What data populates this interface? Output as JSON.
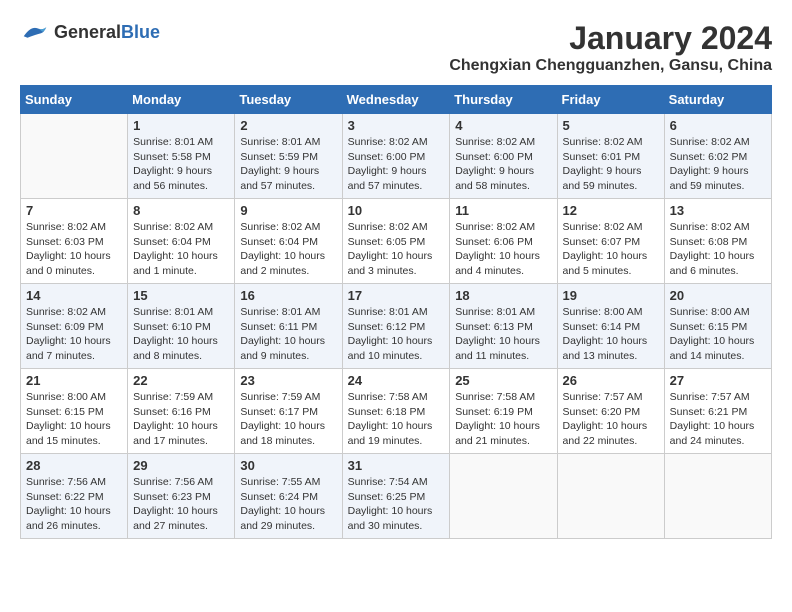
{
  "header": {
    "logo_line1": "General",
    "logo_line2": "Blue",
    "month": "January 2024",
    "location": "Chengxian Chengguanzhen, Gansu, China"
  },
  "weekdays": [
    "Sunday",
    "Monday",
    "Tuesday",
    "Wednesday",
    "Thursday",
    "Friday",
    "Saturday"
  ],
  "weeks": [
    [
      {
        "day": "",
        "sunrise": "",
        "sunset": "",
        "daylight": ""
      },
      {
        "day": "1",
        "sunrise": "Sunrise: 8:01 AM",
        "sunset": "Sunset: 5:58 PM",
        "daylight": "Daylight: 9 hours and 56 minutes."
      },
      {
        "day": "2",
        "sunrise": "Sunrise: 8:01 AM",
        "sunset": "Sunset: 5:59 PM",
        "daylight": "Daylight: 9 hours and 57 minutes."
      },
      {
        "day": "3",
        "sunrise": "Sunrise: 8:02 AM",
        "sunset": "Sunset: 6:00 PM",
        "daylight": "Daylight: 9 hours and 57 minutes."
      },
      {
        "day": "4",
        "sunrise": "Sunrise: 8:02 AM",
        "sunset": "Sunset: 6:00 PM",
        "daylight": "Daylight: 9 hours and 58 minutes."
      },
      {
        "day": "5",
        "sunrise": "Sunrise: 8:02 AM",
        "sunset": "Sunset: 6:01 PM",
        "daylight": "Daylight: 9 hours and 59 minutes."
      },
      {
        "day": "6",
        "sunrise": "Sunrise: 8:02 AM",
        "sunset": "Sunset: 6:02 PM",
        "daylight": "Daylight: 9 hours and 59 minutes."
      }
    ],
    [
      {
        "day": "7",
        "sunrise": "Sunrise: 8:02 AM",
        "sunset": "Sunset: 6:03 PM",
        "daylight": "Daylight: 10 hours and 0 minutes."
      },
      {
        "day": "8",
        "sunrise": "Sunrise: 8:02 AM",
        "sunset": "Sunset: 6:04 PM",
        "daylight": "Daylight: 10 hours and 1 minute."
      },
      {
        "day": "9",
        "sunrise": "Sunrise: 8:02 AM",
        "sunset": "Sunset: 6:04 PM",
        "daylight": "Daylight: 10 hours and 2 minutes."
      },
      {
        "day": "10",
        "sunrise": "Sunrise: 8:02 AM",
        "sunset": "Sunset: 6:05 PM",
        "daylight": "Daylight: 10 hours and 3 minutes."
      },
      {
        "day": "11",
        "sunrise": "Sunrise: 8:02 AM",
        "sunset": "Sunset: 6:06 PM",
        "daylight": "Daylight: 10 hours and 4 minutes."
      },
      {
        "day": "12",
        "sunrise": "Sunrise: 8:02 AM",
        "sunset": "Sunset: 6:07 PM",
        "daylight": "Daylight: 10 hours and 5 minutes."
      },
      {
        "day": "13",
        "sunrise": "Sunrise: 8:02 AM",
        "sunset": "Sunset: 6:08 PM",
        "daylight": "Daylight: 10 hours and 6 minutes."
      }
    ],
    [
      {
        "day": "14",
        "sunrise": "Sunrise: 8:02 AM",
        "sunset": "Sunset: 6:09 PM",
        "daylight": "Daylight: 10 hours and 7 minutes."
      },
      {
        "day": "15",
        "sunrise": "Sunrise: 8:01 AM",
        "sunset": "Sunset: 6:10 PM",
        "daylight": "Daylight: 10 hours and 8 minutes."
      },
      {
        "day": "16",
        "sunrise": "Sunrise: 8:01 AM",
        "sunset": "Sunset: 6:11 PM",
        "daylight": "Daylight: 10 hours and 9 minutes."
      },
      {
        "day": "17",
        "sunrise": "Sunrise: 8:01 AM",
        "sunset": "Sunset: 6:12 PM",
        "daylight": "Daylight: 10 hours and 10 minutes."
      },
      {
        "day": "18",
        "sunrise": "Sunrise: 8:01 AM",
        "sunset": "Sunset: 6:13 PM",
        "daylight": "Daylight: 10 hours and 11 minutes."
      },
      {
        "day": "19",
        "sunrise": "Sunrise: 8:00 AM",
        "sunset": "Sunset: 6:14 PM",
        "daylight": "Daylight: 10 hours and 13 minutes."
      },
      {
        "day": "20",
        "sunrise": "Sunrise: 8:00 AM",
        "sunset": "Sunset: 6:15 PM",
        "daylight": "Daylight: 10 hours and 14 minutes."
      }
    ],
    [
      {
        "day": "21",
        "sunrise": "Sunrise: 8:00 AM",
        "sunset": "Sunset: 6:15 PM",
        "daylight": "Daylight: 10 hours and 15 minutes."
      },
      {
        "day": "22",
        "sunrise": "Sunrise: 7:59 AM",
        "sunset": "Sunset: 6:16 PM",
        "daylight": "Daylight: 10 hours and 17 minutes."
      },
      {
        "day": "23",
        "sunrise": "Sunrise: 7:59 AM",
        "sunset": "Sunset: 6:17 PM",
        "daylight": "Daylight: 10 hours and 18 minutes."
      },
      {
        "day": "24",
        "sunrise": "Sunrise: 7:58 AM",
        "sunset": "Sunset: 6:18 PM",
        "daylight": "Daylight: 10 hours and 19 minutes."
      },
      {
        "day": "25",
        "sunrise": "Sunrise: 7:58 AM",
        "sunset": "Sunset: 6:19 PM",
        "daylight": "Daylight: 10 hours and 21 minutes."
      },
      {
        "day": "26",
        "sunrise": "Sunrise: 7:57 AM",
        "sunset": "Sunset: 6:20 PM",
        "daylight": "Daylight: 10 hours and 22 minutes."
      },
      {
        "day": "27",
        "sunrise": "Sunrise: 7:57 AM",
        "sunset": "Sunset: 6:21 PM",
        "daylight": "Daylight: 10 hours and 24 minutes."
      }
    ],
    [
      {
        "day": "28",
        "sunrise": "Sunrise: 7:56 AM",
        "sunset": "Sunset: 6:22 PM",
        "daylight": "Daylight: 10 hours and 26 minutes."
      },
      {
        "day": "29",
        "sunrise": "Sunrise: 7:56 AM",
        "sunset": "Sunset: 6:23 PM",
        "daylight": "Daylight: 10 hours and 27 minutes."
      },
      {
        "day": "30",
        "sunrise": "Sunrise: 7:55 AM",
        "sunset": "Sunset: 6:24 PM",
        "daylight": "Daylight: 10 hours and 29 minutes."
      },
      {
        "day": "31",
        "sunrise": "Sunrise: 7:54 AM",
        "sunset": "Sunset: 6:25 PM",
        "daylight": "Daylight: 10 hours and 30 minutes."
      },
      {
        "day": "",
        "sunrise": "",
        "sunset": "",
        "daylight": ""
      },
      {
        "day": "",
        "sunrise": "",
        "sunset": "",
        "daylight": ""
      },
      {
        "day": "",
        "sunrise": "",
        "sunset": "",
        "daylight": ""
      }
    ]
  ]
}
